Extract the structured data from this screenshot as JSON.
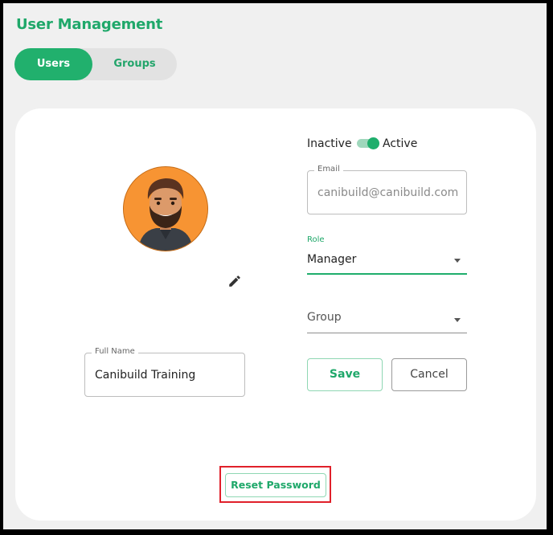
{
  "page": {
    "title": "User Management"
  },
  "tabs": [
    {
      "label": "Users",
      "active": true
    },
    {
      "label": "Groups",
      "active": false
    }
  ],
  "status": {
    "inactive_label": "Inactive",
    "active_label": "Active",
    "is_active": true
  },
  "email": {
    "label": "Email",
    "value": "canibuild@canibuild.com"
  },
  "role": {
    "label": "Role",
    "value": "Manager"
  },
  "group": {
    "label": "Group",
    "value": ""
  },
  "full_name": {
    "label": "Full Name",
    "value": "Canibuild Training"
  },
  "actions": {
    "save_label": "Save",
    "cancel_label": "Cancel",
    "reset_password_label": "Reset Password"
  },
  "colors": {
    "accent": "#21b06d",
    "highlight": "#e0202a",
    "background": "#f0f0f0",
    "card": "#ffffff",
    "avatar_background": "#f79433"
  },
  "icons": {
    "edit": "pencil-icon",
    "dropdown": "caret-down-icon",
    "avatar": "user-avatar-illustration"
  }
}
